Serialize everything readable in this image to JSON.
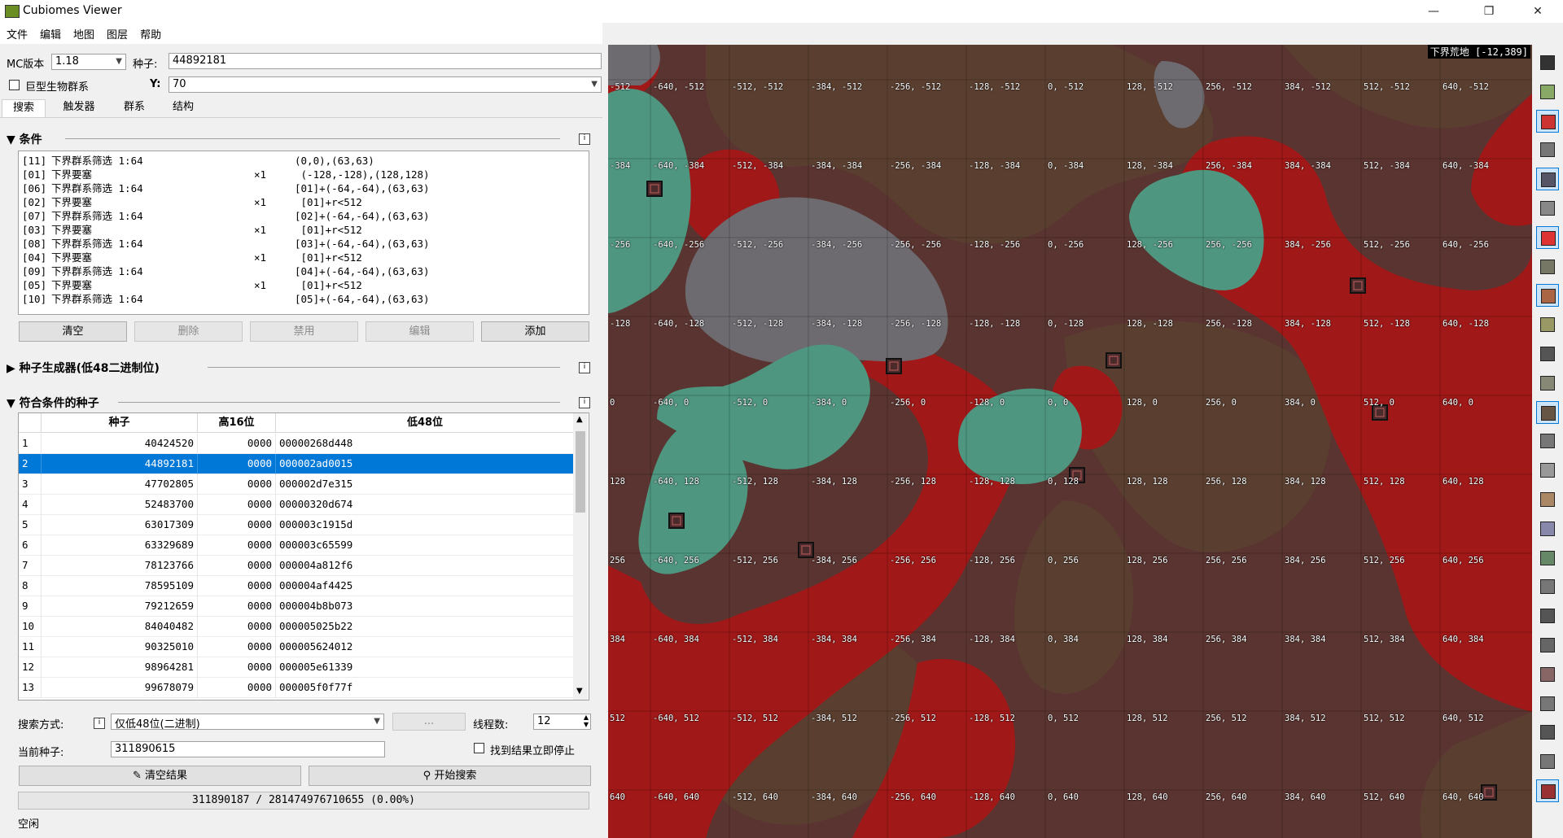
{
  "window": {
    "title": "Cubiomes Viewer",
    "minimize": "—",
    "maximize": "❐",
    "close": "✕"
  },
  "menu": [
    "文件",
    "编辑",
    "地图",
    "图层",
    "帮助"
  ],
  "top": {
    "mc_version_label": "MC版本",
    "mc_version_value": "1.18",
    "seed_label": "种子:",
    "seed_value": "44892181",
    "large_biomes_label": "巨型生物群系",
    "y_label": "Y:",
    "y_value": "70"
  },
  "tabs": [
    "搜索",
    "触发器",
    "群系",
    "结构"
  ],
  "conditions": {
    "title": "条件",
    "rows": [
      {
        "id": "[11]",
        "name": "下界群系筛选 1:64",
        "count": "",
        "arg": "(0,0),(63,63)"
      },
      {
        "id": "[01]",
        "name": "下界要塞",
        "count": "×1",
        "arg": " (-128,-128),(128,128)"
      },
      {
        "id": "[06]",
        "name": "下界群系筛选 1:64",
        "count": "",
        "arg": "[01]+(-64,-64),(63,63)"
      },
      {
        "id": "[02]",
        "name": "下界要塞",
        "count": "×1",
        "arg": " [01]+r<512"
      },
      {
        "id": "[07]",
        "name": "下界群系筛选 1:64",
        "count": "",
        "arg": "[02]+(-64,-64),(63,63)"
      },
      {
        "id": "[03]",
        "name": "下界要塞",
        "count": "×1",
        "arg": " [01]+r<512"
      },
      {
        "id": "[08]",
        "name": "下界群系筛选 1:64",
        "count": "",
        "arg": "[03]+(-64,-64),(63,63)"
      },
      {
        "id": "[04]",
        "name": "下界要塞",
        "count": "×1",
        "arg": " [01]+r<512"
      },
      {
        "id": "[09]",
        "name": "下界群系筛选 1:64",
        "count": "",
        "arg": "[04]+(-64,-64),(63,63)"
      },
      {
        "id": "[05]",
        "name": "下界要塞",
        "count": "×1",
        "arg": " [01]+r<512"
      },
      {
        "id": "[10]",
        "name": "下界群系筛选 1:64",
        "count": "",
        "arg": "[05]+(-64,-64),(63,63)"
      }
    ],
    "buttons": {
      "clear": "清空",
      "delete": "删除",
      "disable": "禁用",
      "edit": "编辑",
      "add": "添加"
    }
  },
  "generator": {
    "title": "种子生成器(低48二进制位)"
  },
  "results": {
    "title": "符合条件的种子",
    "headers": [
      "种子",
      "高16位",
      "低48位"
    ],
    "rows": [
      {
        "n": "1",
        "seed": "40424520",
        "hi": "0000",
        "lo": "00000268d448"
      },
      {
        "n": "2",
        "seed": "44892181",
        "hi": "0000",
        "lo": "000002ad0015"
      },
      {
        "n": "3",
        "seed": "47702805",
        "hi": "0000",
        "lo": "000002d7e315"
      },
      {
        "n": "4",
        "seed": "52483700",
        "hi": "0000",
        "lo": "00000320d674"
      },
      {
        "n": "5",
        "seed": "63017309",
        "hi": "0000",
        "lo": "000003c1915d"
      },
      {
        "n": "6",
        "seed": "63329689",
        "hi": "0000",
        "lo": "000003c65599"
      },
      {
        "n": "7",
        "seed": "78123766",
        "hi": "0000",
        "lo": "000004a812f6"
      },
      {
        "n": "8",
        "seed": "78595109",
        "hi": "0000",
        "lo": "000004af4425"
      },
      {
        "n": "9",
        "seed": "79212659",
        "hi": "0000",
        "lo": "000004b8b073"
      },
      {
        "n": "10",
        "seed": "84040482",
        "hi": "0000",
        "lo": "000005025b22"
      },
      {
        "n": "11",
        "seed": "90325010",
        "hi": "0000",
        "lo": "000005624012"
      },
      {
        "n": "12",
        "seed": "98964281",
        "hi": "0000",
        "lo": "000005e61339"
      },
      {
        "n": "13",
        "seed": "99678079",
        "hi": "0000",
        "lo": "000005f0f77f"
      }
    ],
    "selected_row": 2
  },
  "search": {
    "mode_label": "搜索方式:",
    "mode_value": "仅低48位(二进制)",
    "dots": "...",
    "threads_label": "线程数:",
    "threads_value": "12",
    "current_seed_label": "当前种子:",
    "current_seed_value": "311890615",
    "stop_label": "找到结果立即停止",
    "clear_results": "清空结果",
    "start_search": "开始搜索",
    "progress": "311890187 / 281474976710655 (0.00%)",
    "status": "空闲"
  },
  "map": {
    "biome_label": "下界荒地 [-12,389]",
    "x_labels": [
      "-640",
      "-512",
      "-384",
      "-256",
      "-128",
      "0",
      "128",
      "256",
      "384",
      "512",
      "640"
    ],
    "y_labels": [
      "-512",
      "-384",
      "-256",
      "-128",
      "0",
      "128",
      "256",
      "384",
      "512",
      "640"
    ],
    "colors": {
      "wastes": "#5a3430",
      "crimson": "#a11818",
      "soul": "#5a3f30",
      "warped": "#4e9680",
      "basalt": "#6d6a70"
    }
  },
  "toolbar_icons": [
    "move-icon",
    "mineshaft-icon",
    "nether-biome-icon",
    "ocean-icon",
    "grid-icon",
    "stone-icon",
    "village-icon",
    "portal-icon",
    "outpost-icon",
    "temple-icon",
    "cave-icon",
    "monument-icon",
    "fortress-icon",
    "ruin-icon",
    "igloo-icon",
    "mansion-icon",
    "end-city-icon",
    "swamp-icon",
    "ship-icon",
    "ancient-city-icon",
    "shipwreck-icon",
    "gateway-icon",
    "trail-icon",
    "bastion-icon",
    "sword-icon",
    "nether-fortress-icon"
  ]
}
